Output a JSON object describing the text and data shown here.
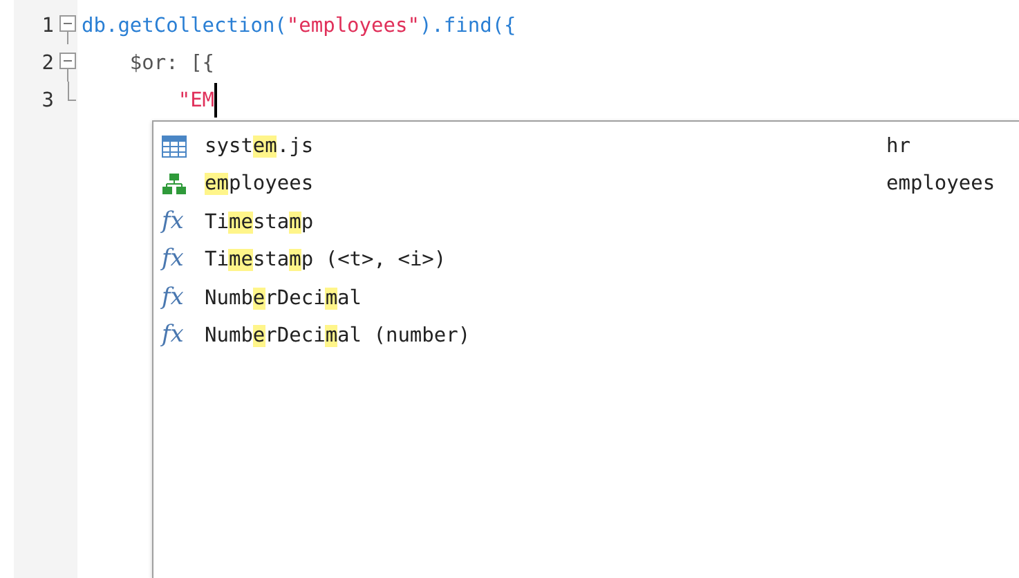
{
  "editor": {
    "lines": [
      {
        "number": "1",
        "foldable": true,
        "expanded": true,
        "tokens": [
          {
            "kind": "code",
            "text": "db.getCollection("
          },
          {
            "kind": "string",
            "text": "\"employees\""
          },
          {
            "kind": "code",
            "text": ").find({"
          }
        ]
      },
      {
        "number": "2",
        "foldable": true,
        "expanded": true,
        "tokens": [
          {
            "kind": "plain",
            "text": "    $or: [{"
          }
        ]
      },
      {
        "number": "3",
        "block_end": true,
        "cursor": true,
        "tokens": [
          {
            "kind": "string",
            "text": "        \"EM"
          }
        ]
      }
    ]
  },
  "autocomplete": {
    "items": [
      {
        "kind": "table",
        "parts": [
          {
            "text": "syst",
            "match": false
          },
          {
            "text": "em",
            "match": true
          },
          {
            "text": ".js",
            "match": false
          }
        ],
        "detail": "hr"
      },
      {
        "kind": "collection",
        "parts": [
          {
            "text": "em",
            "match": true
          },
          {
            "text": "ployees",
            "match": false
          }
        ],
        "detail": "employees"
      },
      {
        "kind": "function",
        "icon_text": "fx",
        "parts": [
          {
            "text": "Ti",
            "match": false
          },
          {
            "text": "m",
            "match": true
          },
          {
            "text": "e",
            "match": true
          },
          {
            "text": "sta",
            "match": false
          },
          {
            "text": "m",
            "match": true
          },
          {
            "text": "p",
            "match": false
          }
        ]
      },
      {
        "kind": "function",
        "icon_text": "fx",
        "parts": [
          {
            "text": "Ti",
            "match": false
          },
          {
            "text": "m",
            "match": true
          },
          {
            "text": "e",
            "match": true
          },
          {
            "text": "sta",
            "match": false
          },
          {
            "text": "m",
            "match": true
          },
          {
            "text": "p (<t>, <i>)",
            "match": false
          }
        ]
      },
      {
        "kind": "function",
        "icon_text": "fx",
        "parts": [
          {
            "text": "Numb",
            "match": false
          },
          {
            "text": "e",
            "match": true
          },
          {
            "text": "rDeci",
            "match": false
          },
          {
            "text": "m",
            "match": true
          },
          {
            "text": "al",
            "match": false
          }
        ]
      },
      {
        "kind": "function",
        "icon_text": "fx",
        "parts": [
          {
            "text": "Numb",
            "match": false
          },
          {
            "text": "e",
            "match": true
          },
          {
            "text": "rDeci",
            "match": false
          },
          {
            "text": "m",
            "match": true
          },
          {
            "text": "al (number)",
            "match": false
          }
        ]
      }
    ]
  }
}
